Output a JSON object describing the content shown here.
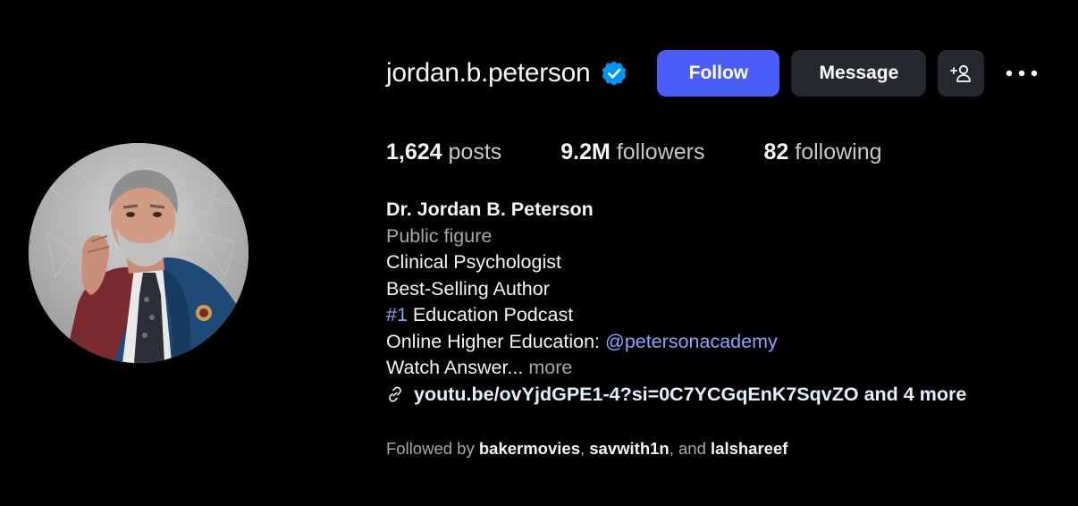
{
  "profile": {
    "username": "jordan.b.peterson",
    "verified": true,
    "avatar_alt": "profile picture"
  },
  "actions": {
    "follow_label": "Follow",
    "message_label": "Message",
    "add_user_icon": "add-user-icon",
    "more_icon": "more-options-icon"
  },
  "stats": {
    "posts_count": "1,624",
    "posts_label": "posts",
    "followers_count": "9.2M",
    "followers_label": "followers",
    "following_count": "82",
    "following_label": "following"
  },
  "bio": {
    "full_name": "Dr. Jordan B. Peterson",
    "category": "Public figure",
    "line1": "Clinical Psychologist",
    "line2": "Best-Selling Author",
    "line3_hashtag": "#1",
    "line3_rest": " Education Podcast",
    "line4_prefix": "Online Higher Education: ",
    "line4_mention": "@petersonacademy",
    "line5_text": "Watch Answer...",
    "more_label": "more",
    "link_text": "youtu.be/ovYjdGPE1-4?si=0C7YCGqEnK7SqvZO and 4 more"
  },
  "followed_by": {
    "prefix": "Followed by ",
    "user1": "bakermovies",
    "sep1": ", ",
    "user2": "savwith1n",
    "sep2": ", and ",
    "user3": "lalshareef"
  },
  "colors": {
    "background": "#000000",
    "follow_button": "#4a5df9",
    "secondary_button": "#25292e",
    "verified_badge": "#0095f6",
    "accent_link": "#8ea2ff"
  }
}
